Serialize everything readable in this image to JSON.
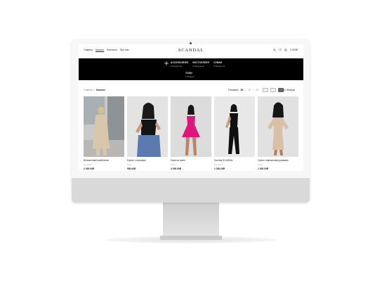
{
  "nav": {
    "links": [
      {
        "label": "Главная"
      },
      {
        "label": "Каталог"
      },
      {
        "label": "Контакты"
      },
      {
        "label": "Про нас"
      }
    ],
    "logo": "SCANDAL",
    "cart_total": "0 000₽"
  },
  "categories": {
    "items": [
      {
        "name": "ACCESSORIES",
        "count": "0 Продуктов"
      },
      {
        "name": "БЕСТСЕЛЛЕР",
        "count": "0 Продуктов"
      },
      {
        "name": "СУМКИ",
        "count": "0 Продуктов"
      }
    ],
    "sub": {
      "name": "ТОПИ",
      "count": "1 Продукт"
    }
  },
  "toolbar": {
    "breadcrumb_home": "Главная",
    "breadcrumb_sep": "/",
    "breadcrumb_current": "Каталог",
    "show_label": "Показати",
    "show_options": [
      {
        "label": "15",
        "selected": true
      },
      {
        "label": "30",
        "selected": false
      },
      {
        "label": "45",
        "selected": false
      }
    ],
    "sep": "/",
    "filters_label": "Фільтри"
  },
  "products": [
    {
      "name": "Вельветовий комбінезон",
      "category": "Костюми",
      "price": "2 000.00₽",
      "colors": {
        "bg": "#c9c9c7",
        "outfit": "#d8c7ad"
      }
    },
    {
      "name": "Корсет з екошкіри",
      "category": "Топи",
      "price": "900.00₽",
      "colors": {
        "bg": "#e3e3e3",
        "outfit": "#141414"
      }
    },
    {
      "name": "Коротка сукня",
      "category": "Сукні",
      "price": "4 000.00₽",
      "colors": {
        "bg": "#dcdcdc",
        "outfit": "#e0147a"
      }
    },
    {
      "name": "Костюм SCANDAL",
      "category": "Костюми",
      "price": "1 300.00₽",
      "colors": {
        "bg": "#e8e8e8",
        "outfit": "#101010"
      }
    },
    {
      "name": "Сукня з вирізанням рукавами",
      "category": "Сукні",
      "price": "1 300.00₽",
      "colors": {
        "bg": "#e1e1e1",
        "outfit": "#d8bfa5"
      }
    }
  ]
}
